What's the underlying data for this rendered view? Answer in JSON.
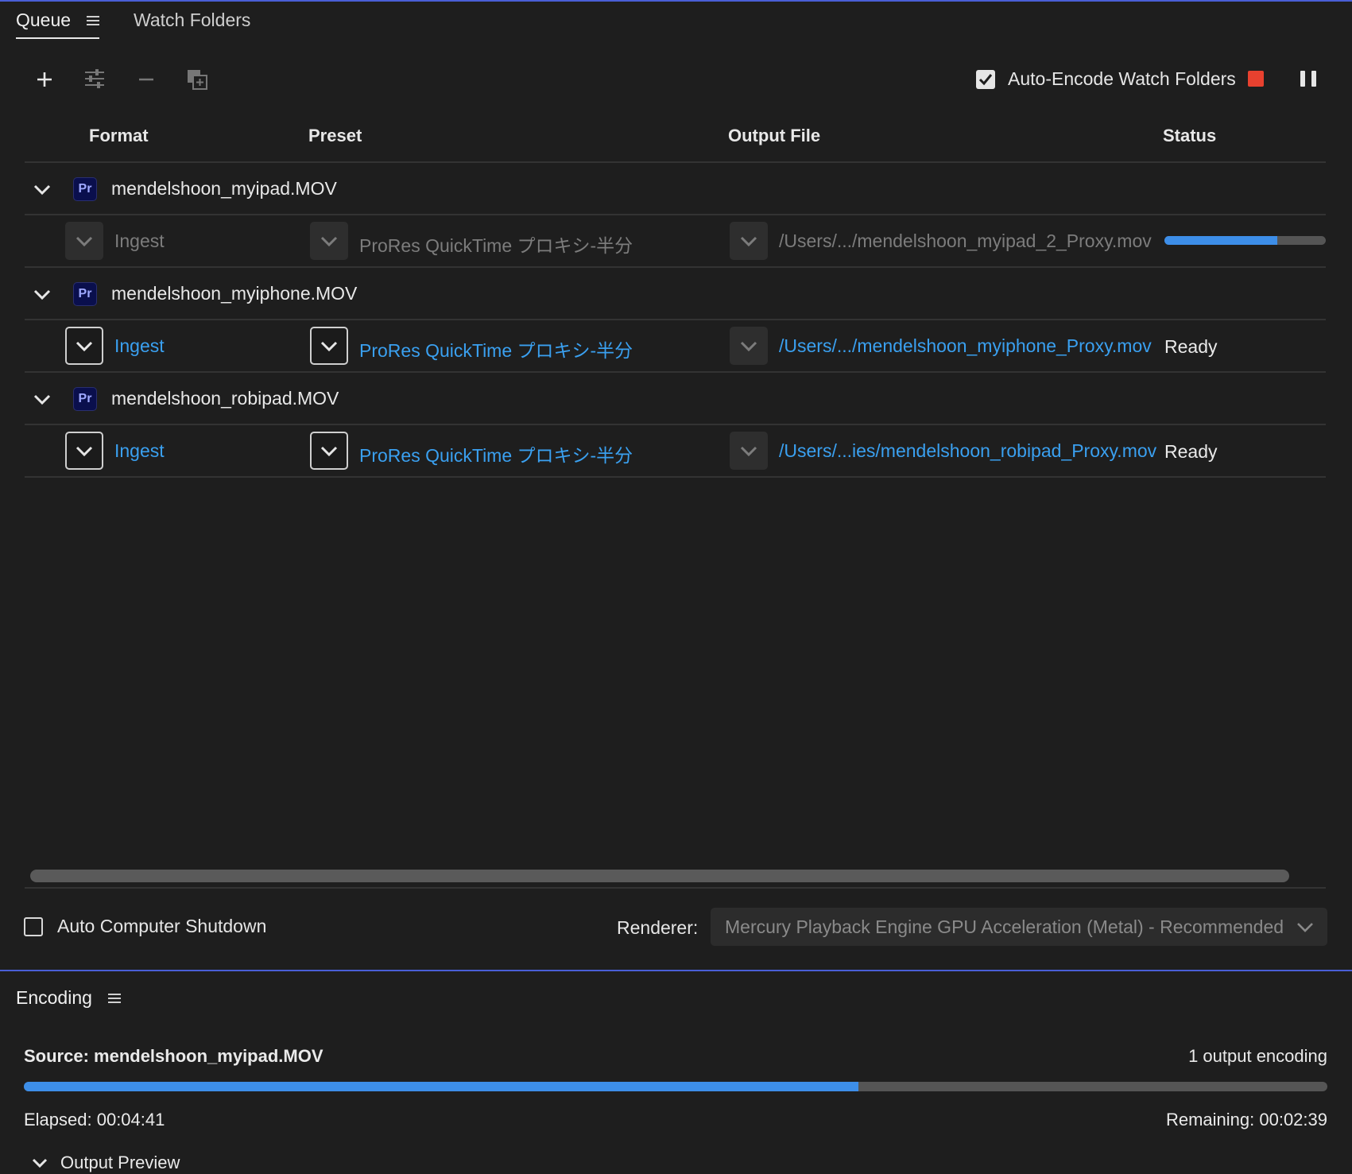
{
  "queue": {
    "tabs": {
      "queue": "Queue",
      "watch_folders": "Watch Folders"
    },
    "toolbar": {
      "auto_encode_label": "Auto-Encode Watch Folders",
      "auto_encode_checked": true
    },
    "columns": {
      "format": "Format",
      "preset": "Preset",
      "output_file": "Output File",
      "status": "Status"
    },
    "items": [
      {
        "source": "mendelshoon_myipad.MOV",
        "badge": "Pr",
        "output": {
          "format": "Ingest",
          "preset": "ProRes QuickTime プロキシ-半分",
          "file": "/Users/.../mendelshoon_myipad_2_Proxy.mov",
          "state": "encoding",
          "progress_pct": 70
        }
      },
      {
        "source": "mendelshoon_myiphone.MOV",
        "badge": "Pr",
        "output": {
          "format": "Ingest",
          "preset": "ProRes QuickTime プロキシ-半分",
          "file": "/Users/.../mendelshoon_myiphone_Proxy.mov",
          "status": "Ready"
        }
      },
      {
        "source": "mendelshoon_robipad.MOV",
        "badge": "Pr",
        "output": {
          "format": "Ingest",
          "preset": "ProRes QuickTime プロキシ-半分",
          "file": "/Users/...ies/mendelshoon_robipad_Proxy.mov",
          "status": "Ready"
        }
      }
    ],
    "footer": {
      "auto_shutdown_label": "Auto Computer Shutdown",
      "auto_shutdown_checked": false,
      "renderer_label": "Renderer:",
      "renderer_value": "Mercury Playback Engine GPU Acceleration (Metal) - Recommended"
    }
  },
  "encoding": {
    "tab": "Encoding",
    "source": "Source: mendelshoon_myipad.MOV",
    "count": "1 output encoding",
    "progress_pct": 64,
    "elapsed": "Elapsed: 00:04:41",
    "remaining": "Remaining: 00:02:39",
    "output_preview": "Output Preview"
  },
  "colors": {
    "accent_blue": "#3d8ee8",
    "link": "#3aa0f0",
    "stop_red": "#e8412f",
    "panel_border": "#4a5fd6"
  },
  "icons": [
    "menu-icon",
    "plus-icon",
    "settings-icon",
    "minus-icon",
    "duplicate-icon",
    "checkmark-icon",
    "stop-icon",
    "pause-icon",
    "chevron-down-icon"
  ]
}
